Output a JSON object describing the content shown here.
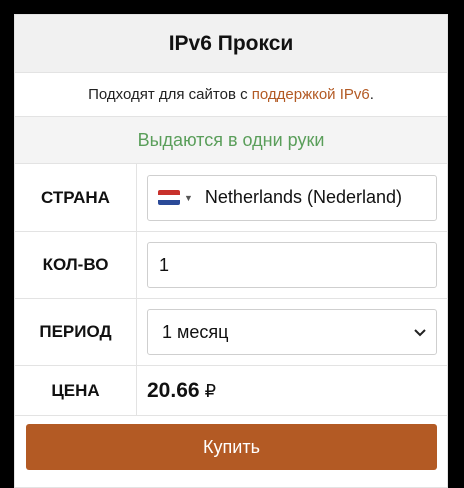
{
  "header": {
    "title": "IPv6 Прокси"
  },
  "subtitle": {
    "prefix": "Подходят для сайтов с ",
    "link": "поддержкой IPv6",
    "suffix": "."
  },
  "notice": "Выдаются в одни руки",
  "form": {
    "country": {
      "label": "СТРАНА",
      "value": "Netherlands (Nederland)",
      "flag_icon": "netherlands-flag"
    },
    "quantity": {
      "label": "КОЛ-ВО",
      "value": "1"
    },
    "period": {
      "label": "ПЕРИОД",
      "value": "1 месяц"
    },
    "price": {
      "label": "ЦЕНА",
      "amount": "20.66",
      "currency": "₽"
    }
  },
  "buy_button": "Купить",
  "colors": {
    "accent": "#b35a24",
    "notice": "#5a9e5a",
    "background": "#000000"
  }
}
